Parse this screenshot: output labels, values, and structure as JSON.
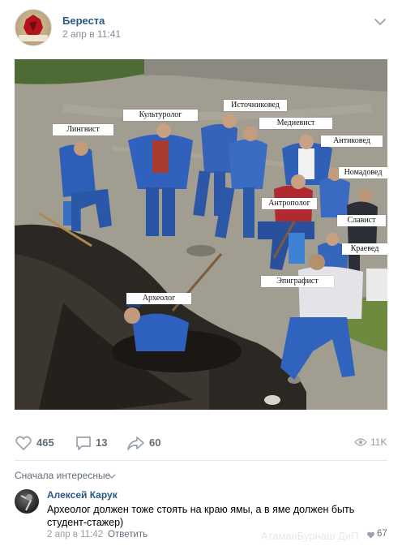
{
  "post": {
    "group_name": "Береста",
    "date": "2 апр в 11:41",
    "avatar_text": "БЕРЕСТА"
  },
  "image": {
    "labels": {
      "lingvist": "Лингвист",
      "kulturolog": "Культуролог",
      "istochnikoved": "Источниковед",
      "medievist": "Медиевист",
      "antikoved": "Антиковед",
      "nomadoved": "Номадовед",
      "antropolog": "Антрополог",
      "slavist": "Славист",
      "kraeved": "Краевед",
      "epigrafist": "Эпиграфист",
      "arkheolog": "Археолог"
    }
  },
  "actions": {
    "likes": "465",
    "comments": "13",
    "shares": "60",
    "views": "11K"
  },
  "comments": {
    "sort_label": "Сначала интересные",
    "items": [
      {
        "author": "Алексей Карук",
        "text": "Археолог должен тоже стоять на краю ямы, а в яме должен быть студент-стажер)",
        "date": "2 апр в 11:42",
        "reply_label": "Ответить",
        "likes": "67"
      }
    ]
  },
  "watermark": "АтаманБурнаш ДиП",
  "colors": {
    "link": "#2a5885",
    "muted": "#818c99",
    "action": "#626d7a",
    "divider": "#e7e8ec",
    "worker_blue": "#2d5fb8"
  },
  "icons": [
    "chevron-down-icon",
    "heart-icon",
    "comment-icon",
    "share-icon",
    "eye-icon"
  ]
}
